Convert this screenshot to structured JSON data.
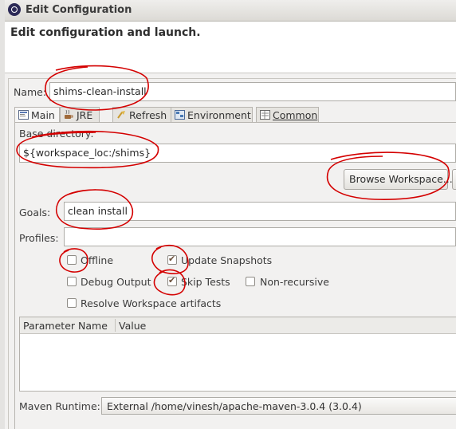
{
  "window": {
    "title": "Edit Configuration"
  },
  "header": {
    "title": "Edit configuration and launch."
  },
  "name_field": {
    "label": "Name:",
    "value": "shims-clean-install"
  },
  "tabs": [
    {
      "label": "Main",
      "icon": "maven-main-icon",
      "active": true
    },
    {
      "label": "JRE",
      "icon": "jre-icon",
      "active": false
    },
    {
      "label": "Refresh",
      "icon": "refresh-icon",
      "active": false
    },
    {
      "label": "Environment",
      "icon": "environment-icon",
      "active": false
    },
    {
      "label": "Common",
      "icon": "common-icon",
      "active": false
    }
  ],
  "main": {
    "base_directory_label": "Base directory:",
    "base_directory_value": "${workspace_loc:/shims}",
    "browse_workspace_label": "Browse Workspace...",
    "goals_label": "Goals:",
    "goals_value": "clean install",
    "profiles_label": "Profiles:",
    "profiles_value": "",
    "options": {
      "offline": {
        "label": "Offline",
        "checked": false
      },
      "update_snapshots": {
        "label": "Update Snapshots",
        "checked": true
      },
      "debug_output": {
        "label": "Debug Output",
        "checked": false
      },
      "skip_tests": {
        "label": "Skip Tests",
        "checked": true
      },
      "non_recursive": {
        "label": "Non-recursive",
        "checked": false
      },
      "resolve_workspace": {
        "label": "Resolve Workspace artifacts",
        "checked": false
      }
    },
    "parameters_table": {
      "columns": [
        "Parameter Name",
        "Value"
      ],
      "rows": []
    },
    "maven_runtime_label": "Maven Runtime:",
    "maven_runtime_value": "External /home/vinesh/apache-maven-3.0.4 (3.0.4)"
  },
  "colors": {
    "annotation": "#d40000",
    "checkmark": "#6b4f3a"
  }
}
